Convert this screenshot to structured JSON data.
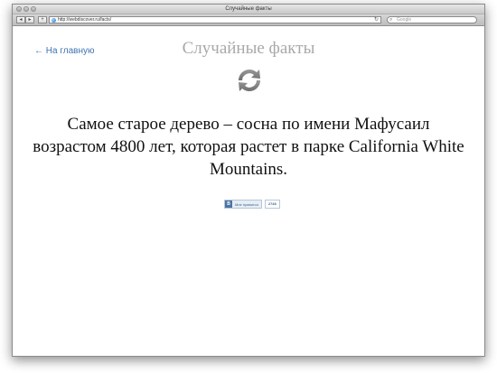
{
  "window": {
    "title": "Случайные факты",
    "url": "http://webdiscover.ru/facts/",
    "search_placeholder": "Google"
  },
  "page": {
    "back_link": "← На главную",
    "heading": "Случайные факты",
    "fact": "Самое старое дерево – сосна по имени Мафусаил возрастом 4800 лет, которая растет в парке California White Mountains.",
    "like_label": "Мне нравится",
    "like_badge": "В",
    "like_count": "2748"
  },
  "colors": {
    "link": "#3f74b3",
    "heading": "#a9a9a9",
    "vk_blue": "#4c75a3"
  },
  "icons": [
    "back-button-icon",
    "forward-button-icon",
    "add-bookmark-icon",
    "globe-icon",
    "reload-icon",
    "search-icon",
    "refresh-arrows-icon"
  ]
}
